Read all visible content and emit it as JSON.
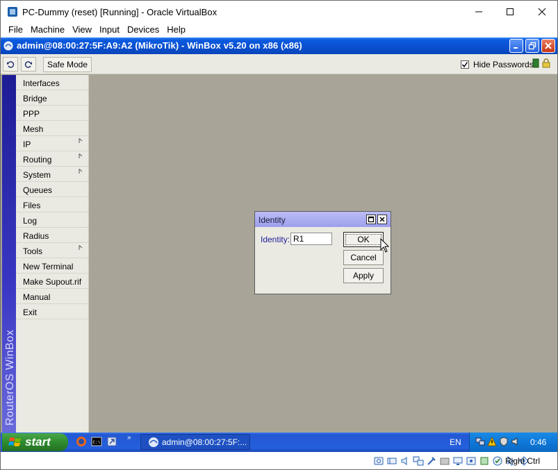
{
  "host": {
    "title": "PC-Dummy (reset) [Running] - Oracle VirtualBox",
    "menu": [
      "File",
      "Machine",
      "View",
      "Input",
      "Devices",
      "Help"
    ],
    "host_key": "Right Ctrl"
  },
  "winbox": {
    "title": "admin@08:00:27:5F:A9:A2 (MikroTik) - WinBox v5.20 on x86 (x86)",
    "safe_mode": "Safe Mode",
    "hide_passwords": "Hide Passwords",
    "hide_passwords_checked": true,
    "brand_strip": "RouterOS WinBox",
    "menu": [
      {
        "label": "Interfaces",
        "submenu": false
      },
      {
        "label": "Bridge",
        "submenu": false
      },
      {
        "label": "PPP",
        "submenu": false
      },
      {
        "label": "Mesh",
        "submenu": false
      },
      {
        "label": "IP",
        "submenu": true
      },
      {
        "label": "Routing",
        "submenu": true
      },
      {
        "label": "System",
        "submenu": true
      },
      {
        "label": "Queues",
        "submenu": false
      },
      {
        "label": "Files",
        "submenu": false
      },
      {
        "label": "Log",
        "submenu": false
      },
      {
        "label": "Radius",
        "submenu": false
      },
      {
        "label": "Tools",
        "submenu": true
      },
      {
        "label": "New Terminal",
        "submenu": false
      },
      {
        "label": "Make Supout.rif",
        "submenu": false
      },
      {
        "label": "Manual",
        "submenu": false
      },
      {
        "label": "Exit",
        "submenu": false
      }
    ]
  },
  "dialog": {
    "title": "Identity",
    "field_label": "Identity:",
    "field_value": "R1",
    "ok": "OK",
    "cancel": "Cancel",
    "apply": "Apply"
  },
  "taskbar": {
    "start": "start",
    "task_label": "admin@08:00:27:5F:...",
    "lang": "EN",
    "clock": "0:46"
  },
  "colors": {
    "xp_title": "#0a4fd0",
    "workspace": "#a8a598",
    "side_strip": "#2c2aae",
    "dialog_title": "#a9abf0"
  }
}
